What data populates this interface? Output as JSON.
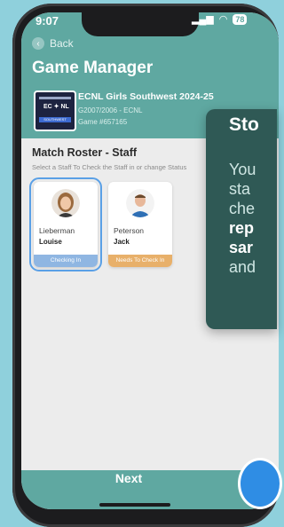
{
  "status_bar": {
    "time": "9:07",
    "battery": "78"
  },
  "nav": {
    "back_label": "Back"
  },
  "header": {
    "title": "Game Manager"
  },
  "event": {
    "name": "ECNL Girls Southwest 2024-25",
    "division": "G2007/2006 - ECNL",
    "game": "Game #657165",
    "logo_text": "SOUTHWEST"
  },
  "roster": {
    "title": "Match Roster - Staff",
    "subtitle": "Select a Staff To Check the Staff in or change Status",
    "staff": [
      {
        "last": "Lieberman",
        "first": "Louise",
        "status": "Checking In",
        "status_color": "#8fb6e2"
      },
      {
        "last": "Peterson",
        "first": "Jack",
        "status": "Needs To Check In",
        "status_color": "#e8b06a"
      }
    ]
  },
  "tooltip": {
    "title": "Sto",
    "lines": [
      "You",
      "sta",
      "che",
      "rep",
      "sar",
      "and"
    ]
  },
  "footer": {
    "next_label": "Next"
  },
  "colors": {
    "brand": "#5fa8a1",
    "tooltip_bg": "#2f5955",
    "selection": "#5aa0e6"
  }
}
